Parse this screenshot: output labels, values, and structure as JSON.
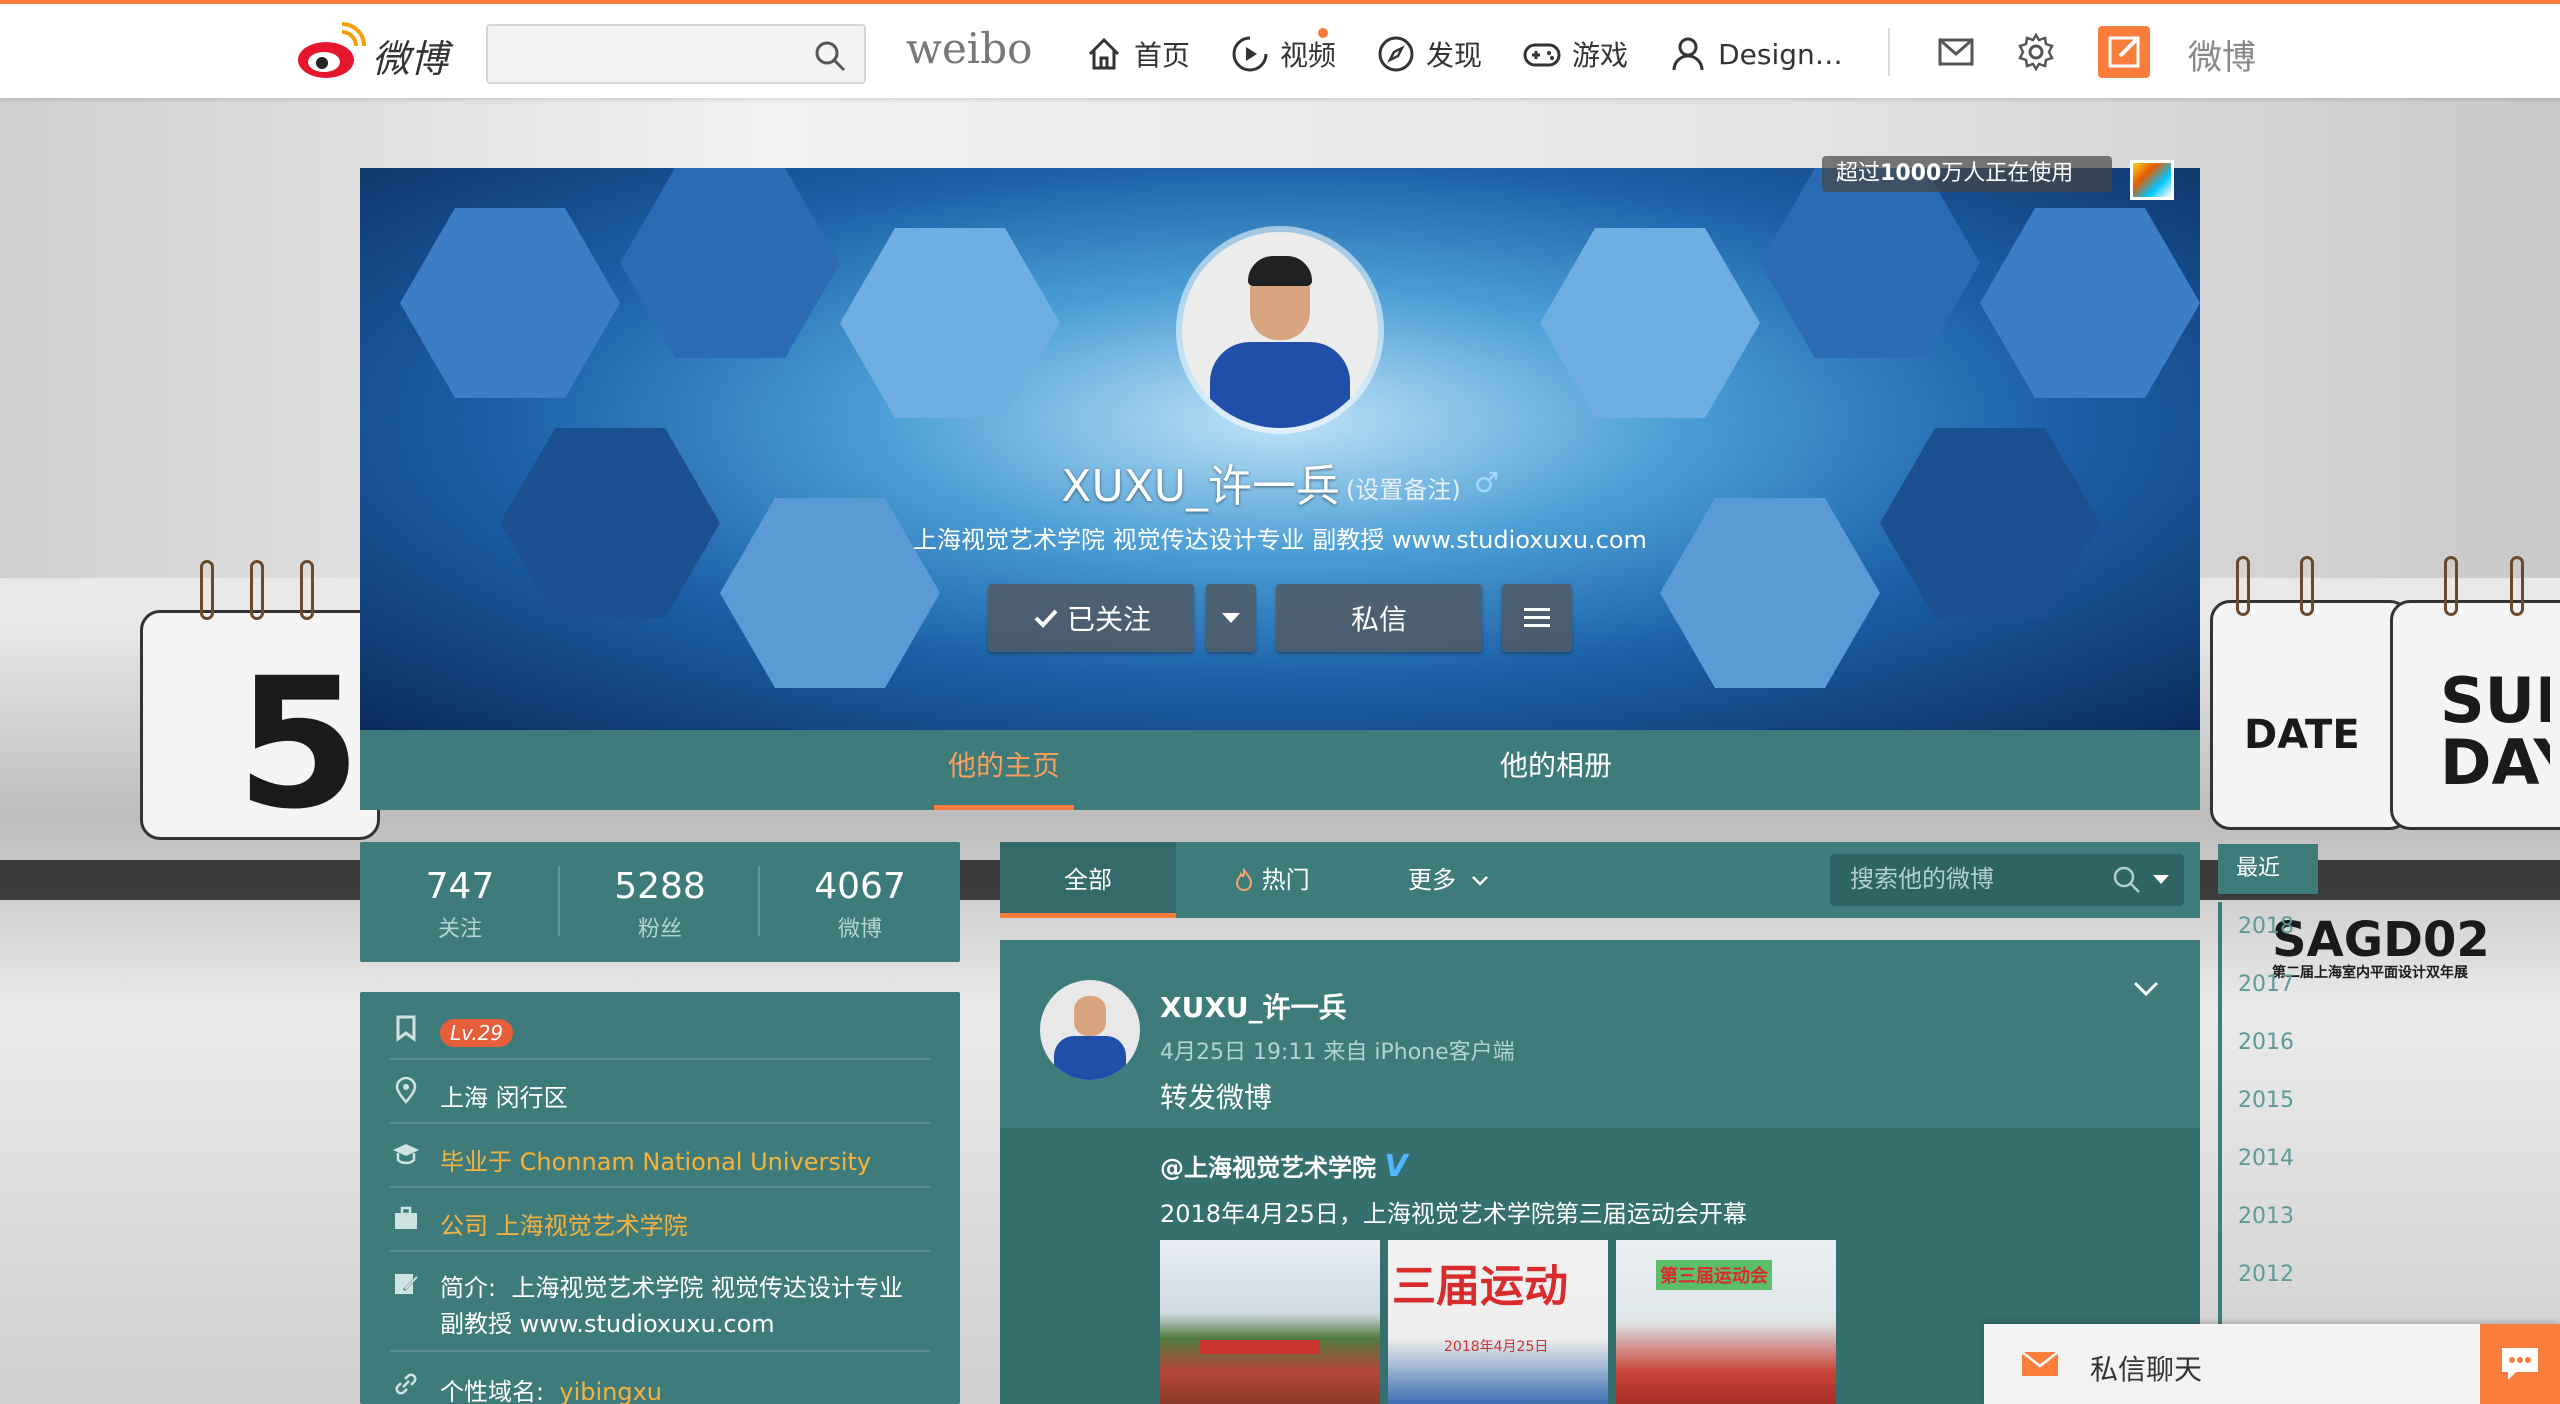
{
  "topbar": {
    "logo_text": "微博",
    "search_placeholder": "",
    "brand_word": "weibo",
    "nav": [
      {
        "label": "首页",
        "icon": "home-icon"
      },
      {
        "label": "视频",
        "icon": "video-icon"
      },
      {
        "label": "发现",
        "icon": "compass-icon"
      },
      {
        "label": "游戏",
        "icon": "gamepad-icon"
      },
      {
        "label": "Design…",
        "icon": "user-icon"
      }
    ],
    "weibo_label": "微博"
  },
  "cover": {
    "tip_prefix": "超过",
    "tip_bold": "1000",
    "tip_suffix": "万人正在使用",
    "name": "XUXU_许一兵",
    "remark": "(设置备注)",
    "gender_symbol": "♂",
    "bio": "上海视觉艺术学院 视觉传达设计专业 副教授 www.studioxuxu.com",
    "follow_label": "已关注",
    "message_label": "私信",
    "tabs": [
      {
        "label": "他的主页",
        "active": true
      },
      {
        "label": "他的相册",
        "active": false
      }
    ]
  },
  "stats": [
    {
      "value": "747",
      "label": "关注"
    },
    {
      "value": "5288",
      "label": "粉丝"
    },
    {
      "value": "4067",
      "label": "微博"
    }
  ],
  "info": {
    "level": "Lv.29",
    "location": "上海 闵行区",
    "school_prefix": "毕业于 ",
    "school": "Chonnam National University",
    "company_prefix": "公司 ",
    "company": "上海视觉艺术学院",
    "bio_prefix": "简介:",
    "bio_line1": "上海视觉艺术学院 视觉传达设计专业",
    "bio_line2": "副教授 www.studioxuxu.com",
    "domain_prefix": "个性域名:",
    "domain": "yibingxu"
  },
  "feed": {
    "tabs": [
      "全部",
      "热门",
      "更多"
    ],
    "search_placeholder": "搜索他的微博",
    "post": {
      "author": "XUXU_许一兵",
      "meta": "4月25日 19:11 来自 iPhone客户端",
      "text": "转发微博",
      "repost_author": "@上海视觉艺术学院",
      "repost_verified": "V",
      "repost_text": "2018年4月25日，上海视觉艺术学院第三届运动会开幕",
      "thumb2_text": "三届运动",
      "thumb2_date": "2018年4月25日",
      "thumb3_text": "第三届运动会"
    }
  },
  "timeline": {
    "recent_label": "最近",
    "years": [
      "2018",
      "2017",
      "2016",
      "2015",
      "2014",
      "2013",
      "2012"
    ]
  },
  "background_text": {
    "left_digit": "5",
    "date": "DATE",
    "sunday": "SUN DAY",
    "sagd": "SAGD02",
    "sagd_sub": "第二届上海室内平面设计双年展"
  },
  "chat": {
    "label": "私信聊天"
  },
  "colors": {
    "accent": "#fa7d3c",
    "panel": "#3e7c7b",
    "link": "#f8b23b"
  }
}
